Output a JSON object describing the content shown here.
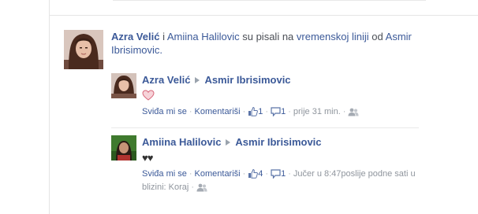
{
  "story": {
    "author": "Azra Velić",
    "and_word": "i",
    "coauthor": "Amiina Halilovic",
    "verb": "su pisali na",
    "place": "vremenskoj liniji",
    "of_word": "od",
    "owner": "Asmir Ibrisimovic."
  },
  "posts": [
    {
      "author": "Azra Velić",
      "target": "Asmir Ibrisimovic",
      "content_icon": "heart-icon",
      "like_label": "Sviđa mi se",
      "comment_label": "Komentariši",
      "like_count": "1",
      "comment_count": "1",
      "time": "prije 31 min.",
      "privacy_icon": "friends-icon"
    },
    {
      "author": "Amiina Halilovic",
      "target": "Asmir Ibrisimovic",
      "content": "♥♥",
      "like_label": "Sviđa mi se",
      "comment_label": "Komentariši",
      "like_count": "4",
      "comment_count": "1",
      "time": "Jučer u 8:47poslije podne sati u blizini:",
      "place": "Koraj",
      "privacy_icon": "friends-icon"
    }
  ],
  "colors": {
    "link": "#3b5998",
    "meta": "#8f959d",
    "heart_fill": "#f7d3d9",
    "heart_stroke": "#d7667a"
  }
}
